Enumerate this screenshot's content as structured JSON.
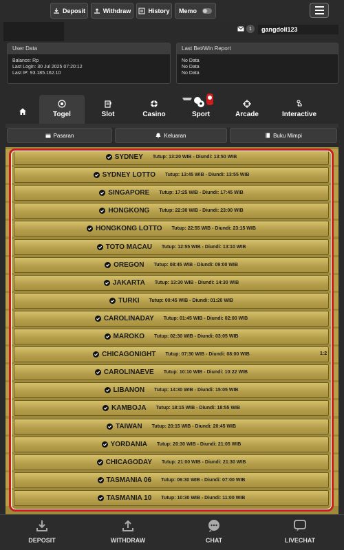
{
  "topbar": {
    "deposit_label": "Deposit",
    "withdraw_label": "Withdraw",
    "history_label": "History",
    "memo_label": "Memo"
  },
  "mail": {
    "count": "1"
  },
  "user": {
    "username": "gangdoll123"
  },
  "user_data": {
    "title": "User Data",
    "balance": "Balance: Rp",
    "last_login": "Last Login: 30 Jul 2025 07:20:12",
    "last_ip": "Last IP: 93.185.162.10"
  },
  "report": {
    "title": "Last Bet/Win Report",
    "lines": [
      "No Data",
      "No Data",
      "No Data"
    ]
  },
  "categories": [
    {
      "label": "",
      "icon": "home-icon"
    },
    {
      "label": "Togel",
      "icon": "lottery-icon"
    },
    {
      "label": "Slot",
      "icon": "slot-icon"
    },
    {
      "label": "Casino",
      "icon": "chip-icon"
    },
    {
      "label": "Sport",
      "icon": "ball-icon"
    },
    {
      "label": "Arcade",
      "icon": "target-icon"
    },
    {
      "label": "Interactive",
      "icon": "touch-icon"
    }
  ],
  "subtabs": {
    "pasaran": "Pasaran",
    "keluaran": "Keluaran",
    "buku_mimpi": "Buku Mimpi"
  },
  "markets": [
    {
      "name": "SYDNEY",
      "time": "Tutup: 13:20 WIB - Diundi: 13:50 WIB"
    },
    {
      "name": "SYDNEY LOTTO",
      "time": "Tutup: 13:45 WIB - Diundi: 13:55 WIB"
    },
    {
      "name": "SINGAPORE",
      "time": "Tutup: 17:25 WIB - Diundi: 17:45 WIB"
    },
    {
      "name": "HONGKONG",
      "time": "Tutup: 22:30 WIB - Diundi: 23:00 WIB"
    },
    {
      "name": "HONGKONG LOTTO",
      "time": "Tutup: 22:55 WIB - Diundi: 23:15 WIB"
    },
    {
      "name": "TOTO MACAU",
      "time": "Tutup: 12:55 WIB - Diundi: 13:10 WIB"
    },
    {
      "name": "OREGON",
      "time": "Tutup: 08:45 WIB - Diundi: 09:00 WIB"
    },
    {
      "name": "JAKARTA",
      "time": "Tutup: 13:30 WIB - Diundi: 14:30 WIB"
    },
    {
      "name": "TURKI",
      "time": "Tutup: 00:45 WIB - Diundi: 01:20 WIB"
    },
    {
      "name": "CAROLINADAY",
      "time": "Tutup: 01:45 WIB - Diundi: 02:00 WIB"
    },
    {
      "name": "MAROKO",
      "time": "Tutup: 02:30 WIB - Diundi: 03:05 WIB"
    },
    {
      "name": "CHICAGONIGHT",
      "time": "Tutup: 07:30 WIB - Diundi: 08:00 WIB"
    },
    {
      "name": "CAROLINAEVE",
      "time": "Tutup: 10:10 WIB - Diundi: 10:22 WIB"
    },
    {
      "name": "LIBANON",
      "time": "Tutup: 14:30 WIB - Diundi: 15:05 WIB"
    },
    {
      "name": "KAMBOJA",
      "time": "Tutup: 18:15 WIB - Diundi: 18:55 WIB"
    },
    {
      "name": "TAIWAN",
      "time": "Tutup: 20:15 WIB - Diundi: 20:45 WIB"
    },
    {
      "name": "YORDANIA",
      "time": "Tutup: 20:30 WIB - Diundi: 21:05 WIB"
    },
    {
      "name": "CHICAGODAY",
      "time": "Tutup: 21:00 WIB - Diundi: 21:30 WIB"
    },
    {
      "name": "TASMANIA 06",
      "time": "Tutup: 06:30 WIB - Diundi: 07:00 WIB"
    },
    {
      "name": "TASMANIA 10",
      "time": "Tutup: 10:30 WIB - Diundi: 11:00 WIB"
    }
  ],
  "stray_text": "1:2",
  "bottom_nav": {
    "deposit": "DEPOSIT",
    "withdraw": "WITHDRAW",
    "chat": "CHAT",
    "livechat": "LIVECHAT"
  },
  "colors": {
    "accent_border": "#c91d1d",
    "row_gold": "#c4ad58",
    "background": "#2a2a2a"
  }
}
